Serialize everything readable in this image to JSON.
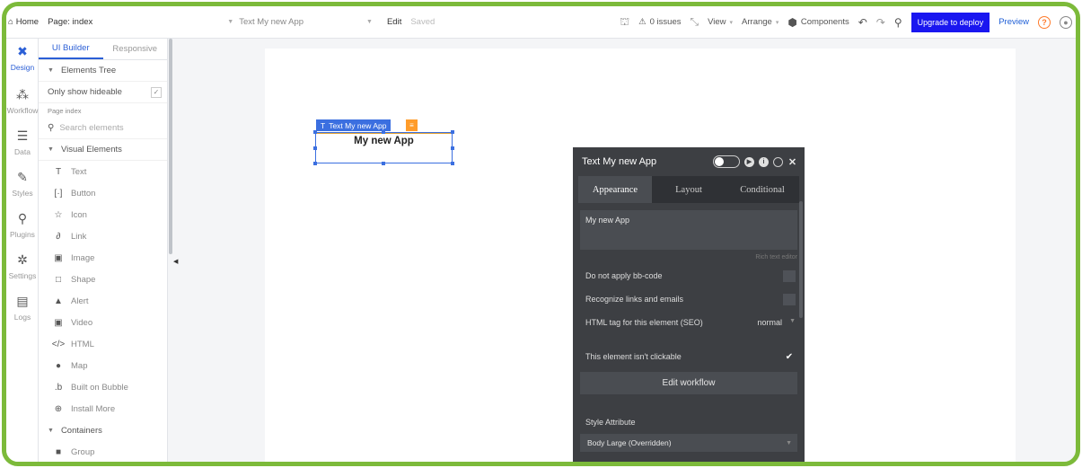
{
  "topbar": {
    "home_label": "Home",
    "page_label": "Page: index",
    "element_label": "Text My new App",
    "edit_label": "Edit",
    "saved_label": "Saved",
    "issues_label": "0 issues",
    "view_label": "View",
    "arrange_label": "Arrange",
    "components_label": "Components",
    "upgrade_label": "Upgrade to deploy",
    "preview_label": "Preview",
    "accent_color": "#1a17f0"
  },
  "rail": {
    "items": [
      {
        "label": "Design",
        "icon": "design-icon"
      },
      {
        "label": "Workflow",
        "icon": "workflow-icon"
      },
      {
        "label": "Data",
        "icon": "data-icon"
      },
      {
        "label": "Styles",
        "icon": "styles-icon"
      },
      {
        "label": "Plugins",
        "icon": "plugins-icon"
      },
      {
        "label": "Settings",
        "icon": "settings-icon"
      },
      {
        "label": "Logs",
        "icon": "logs-icon"
      }
    ]
  },
  "panel": {
    "tabs": [
      "UI Builder",
      "Responsive"
    ],
    "elements_tree": "Elements Tree",
    "only_hideable": "Only show hideable",
    "page_index": "Page index",
    "search_placeholder": "Search elements",
    "visual_elements": "Visual Elements",
    "elements": [
      {
        "label": "Text",
        "icon": "text-icon",
        "glyph": "T"
      },
      {
        "label": "Button",
        "icon": "button-icon",
        "glyph": "[·]"
      },
      {
        "label": "Icon",
        "icon": "star-icon",
        "glyph": "☆"
      },
      {
        "label": "Link",
        "icon": "link-icon",
        "glyph": "∂"
      },
      {
        "label": "Image",
        "icon": "image-icon",
        "glyph": "▣"
      },
      {
        "label": "Shape",
        "icon": "shape-icon",
        "glyph": "□"
      },
      {
        "label": "Alert",
        "icon": "alert-icon",
        "glyph": "▲"
      },
      {
        "label": "Video",
        "icon": "video-icon",
        "glyph": "▣"
      },
      {
        "label": "HTML",
        "icon": "html-icon",
        "glyph": "</>"
      },
      {
        "label": "Map",
        "icon": "map-pin-icon",
        "glyph": "●"
      },
      {
        "label": "Built on Bubble",
        "icon": "bubble-logo-icon",
        "glyph": ".b"
      },
      {
        "label": "Install More",
        "icon": "plus-circle-icon",
        "glyph": "⊕"
      }
    ],
    "containers": "Containers",
    "group_label": "Group"
  },
  "canvas": {
    "selected_label": "Text My new App",
    "selected_text": "My new App"
  },
  "editor": {
    "title": "Text My new App",
    "tabs": [
      "Appearance",
      "Layout",
      "Conditional"
    ],
    "text_value": "My new App",
    "rich_text": "Rich text editor",
    "no_bbcode": "Do not apply bb-code",
    "recognize_links": "Recognize links and emails",
    "html_tag_label": "HTML tag for this element (SEO)",
    "html_tag_value": "normal",
    "not_clickable": "This element isn't clickable",
    "edit_workflow": "Edit workflow",
    "style_attribute": "Style Attribute",
    "style_value": "Body Large (Overridden)"
  }
}
